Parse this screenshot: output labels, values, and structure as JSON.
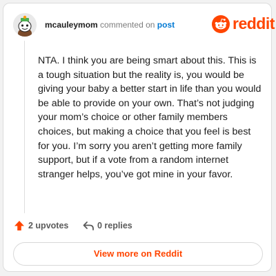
{
  "header": {
    "username": "mcauleymom",
    "action_text": "commented on",
    "post_link": "post",
    "brand_name": "reddit",
    "avatar_icon": "snoo-avatar-icon",
    "brand_icon": "reddit-snoo-icon"
  },
  "comment": {
    "body": "NTA. I think you are being smart about this. This is a tough situation but the reality is, you would be giving your baby a better start in life than you would be able to provide on your own. That’s not judging your mom’s choice or other family members choices, but making a choice that you feel is best for you. I’m sorry you aren’t getting more family support, but if a vote from a random internet stranger helps, you’ve got mine in your favor."
  },
  "actions": {
    "upvotes_label": "2 upvotes",
    "replies_label": "0 replies",
    "upvote_icon": "upvote-arrow-icon",
    "reply_icon": "reply-arrow-icon"
  },
  "footer": {
    "view_more_label": "View more on Reddit"
  },
  "colors": {
    "brand": "#ff4500",
    "link": "#0079d3",
    "text": "#1c1c1c",
    "muted": "#7c7c7c"
  }
}
